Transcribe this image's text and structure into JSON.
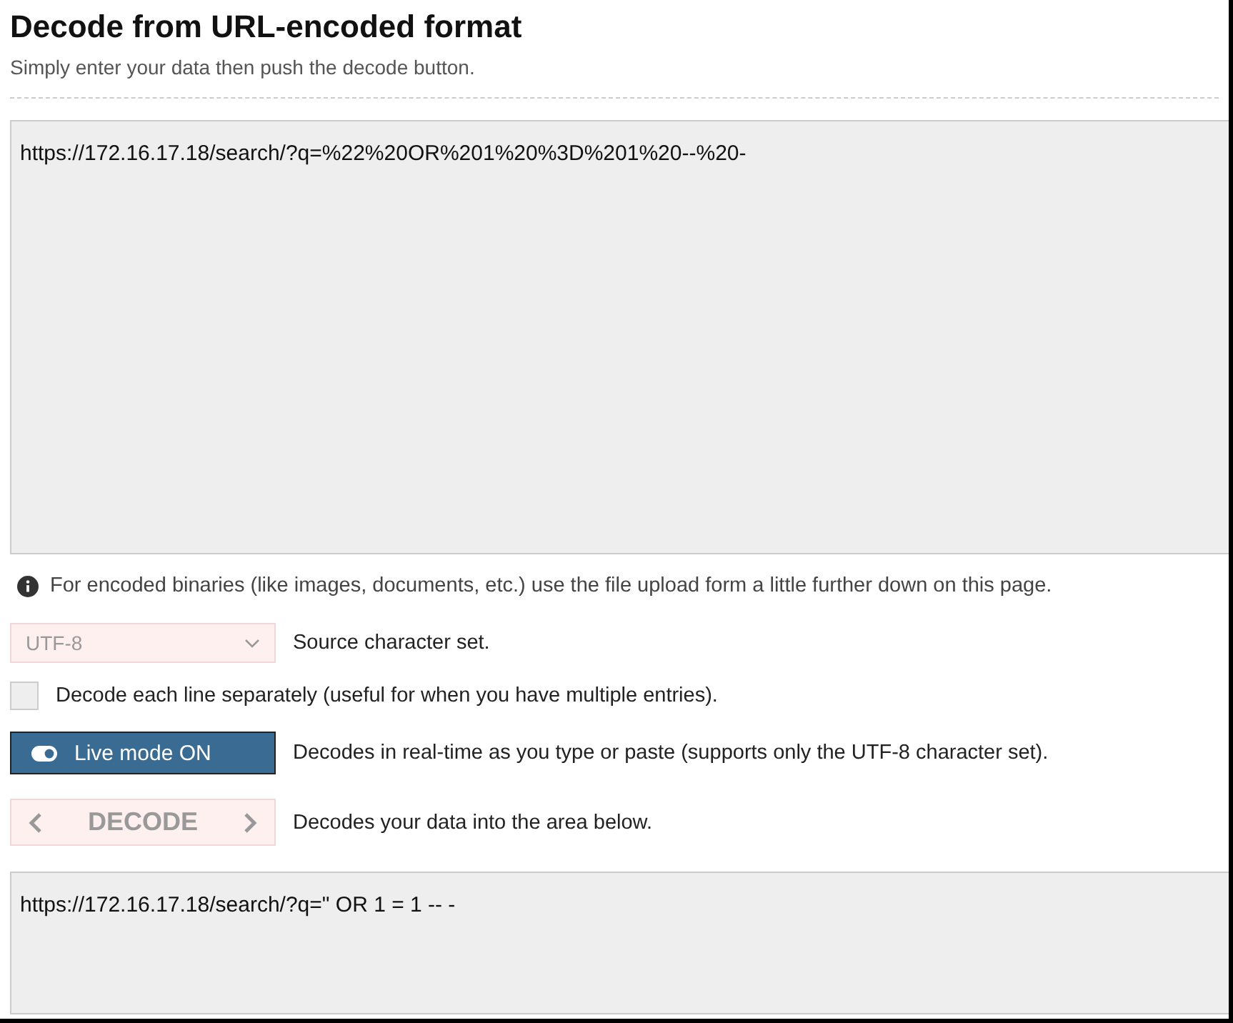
{
  "title": "Decode from URL-encoded format",
  "subtitle": "Simply enter your data then push the decode button.",
  "input": {
    "value": "https://172.16.17.18/search/?q=%22%20OR%201%20%3D%201%20--%20-"
  },
  "info": "For encoded binaries (like images, documents, etc.) use the file upload form a little further down on this page.",
  "charset": {
    "value": "UTF-8",
    "disabled": true,
    "label": "Source character set."
  },
  "line_separately": {
    "checked": false,
    "label": "Decode each line separately (useful for when you have multiple entries)."
  },
  "live_mode": {
    "on": true,
    "label": "Live mode ON",
    "description": "Decodes in real-time as you type or paste (supports only the UTF-8 character set)."
  },
  "decode_button": {
    "label": "DECODE",
    "disabled": true,
    "description": "Decodes your data into the area below."
  },
  "output": {
    "value": "https://172.16.17.18/search/?q=\" OR 1 = 1 -- -"
  }
}
